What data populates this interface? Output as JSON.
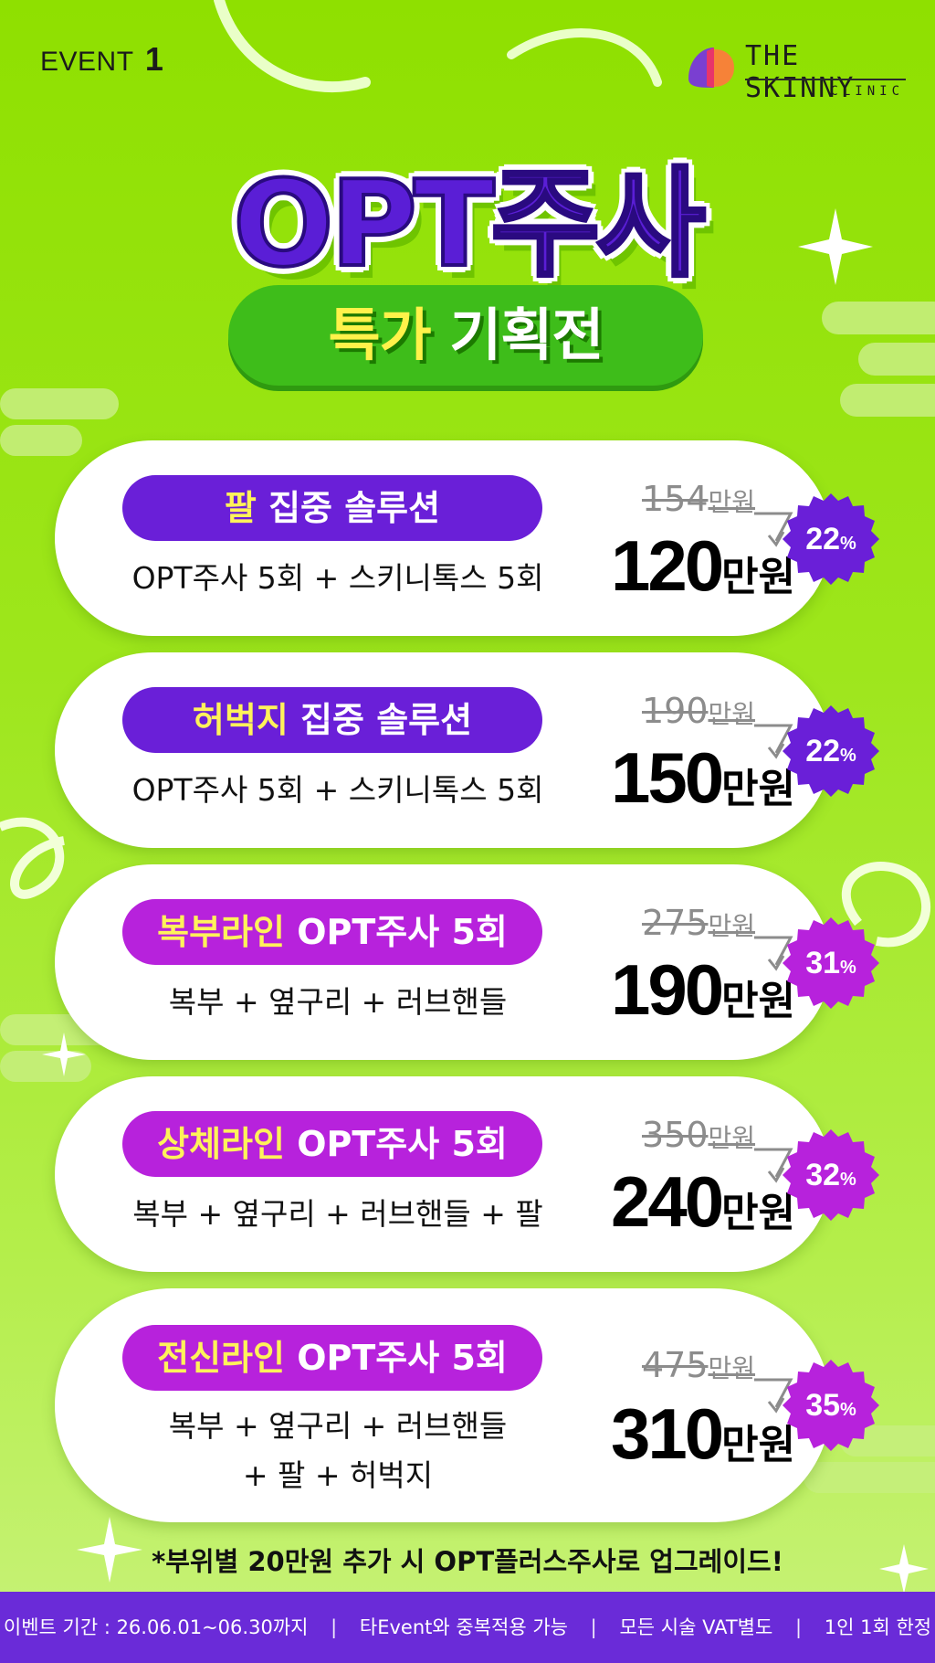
{
  "header": {
    "event_text": "EVENT",
    "event_number": "1",
    "logo_name": "THE SKINNY",
    "logo_sub": "CLINIC"
  },
  "title": {
    "main": "OPT주사",
    "sub_a": "특가",
    "sub_b": "기획전"
  },
  "colors": {
    "background": "#8fe000",
    "purple": "#6a1fd8",
    "magenta": "#b722dc",
    "highlight": "#fff25a",
    "footer": "#6a2bd8"
  },
  "products": [
    {
      "tag_highlight": "팔",
      "tag_rest": " 집중 솔루션",
      "desc_line1": "OPT주사 5회 + 스키니톡스 5회",
      "desc_line2": "",
      "original_num": "154",
      "original_unit": "만원",
      "price_num": "120",
      "price_unit": "만원",
      "discount_num": "22",
      "discount_unit": "%",
      "color": "purple"
    },
    {
      "tag_highlight": "허벅지",
      "tag_rest": " 집중 솔루션",
      "desc_line1": "OPT주사 5회 + 스키니톡스 5회",
      "desc_line2": "",
      "original_num": "190",
      "original_unit": "만원",
      "price_num": "150",
      "price_unit": "만원",
      "discount_num": "22",
      "discount_unit": "%",
      "color": "purple"
    },
    {
      "tag_highlight": "복부라인",
      "tag_rest": " OPT주사 5회",
      "desc_line1": "복부 + 옆구리 + 러브핸들",
      "desc_line2": "",
      "original_num": "275",
      "original_unit": "만원",
      "price_num": "190",
      "price_unit": "만원",
      "discount_num": "31",
      "discount_unit": "%",
      "color": "magenta"
    },
    {
      "tag_highlight": "상체라인",
      "tag_rest": " OPT주사 5회",
      "desc_line1": "복부 + 옆구리 + 러브핸들 + 팔",
      "desc_line2": "",
      "original_num": "350",
      "original_unit": "만원",
      "price_num": "240",
      "price_unit": "만원",
      "discount_num": "32",
      "discount_unit": "%",
      "color": "magenta"
    },
    {
      "tag_highlight": "전신라인",
      "tag_rest": " OPT주사 5회",
      "desc_line1": "복부 + 옆구리 + 러브핸들",
      "desc_line2": "+ 팔 + 허벅지",
      "original_num": "475",
      "original_unit": "만원",
      "price_num": "310",
      "price_unit": "만원",
      "discount_num": "35",
      "discount_unit": "%",
      "color": "magenta"
    }
  ],
  "note": "*부위별 20만원 추가 시 OPT플러스주사로 업그레이드!",
  "footer": {
    "period": "이벤트 기간 : 26.06.01~06.30까지",
    "dup": "타Event와 중복적용 가능",
    "vat": "모든 시술 VAT별도",
    "limit": "1인 1회 한정",
    "separator": "|"
  }
}
